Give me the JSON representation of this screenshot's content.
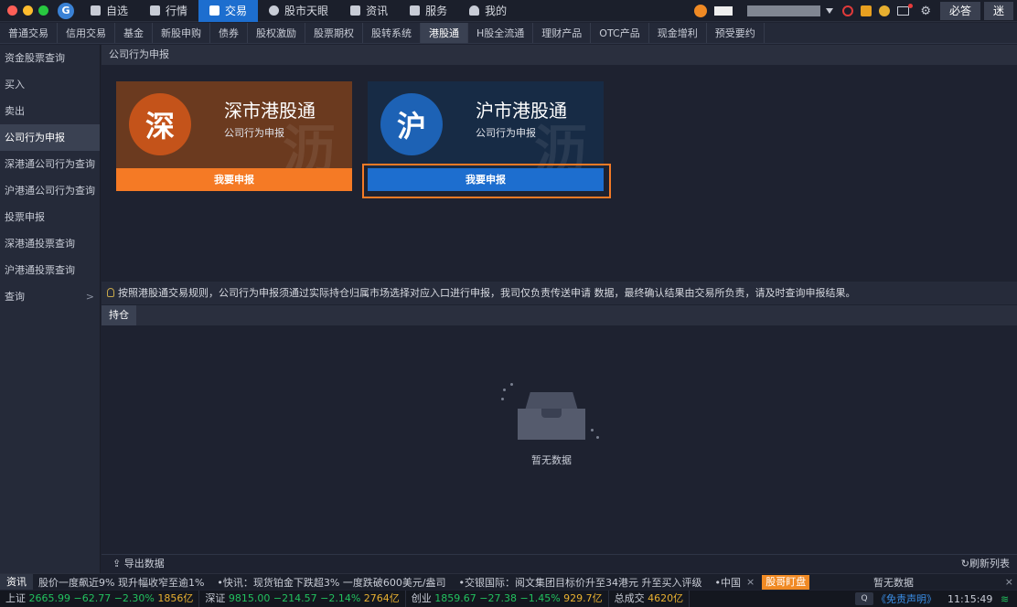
{
  "topnav": [
    {
      "label": "自选",
      "icon": "star-square-icon"
    },
    {
      "label": "行情",
      "icon": "chart-icon"
    },
    {
      "label": "交易",
      "icon": "trade-icon",
      "active": true
    },
    {
      "label": "股市天眼",
      "icon": "eye-icon"
    },
    {
      "label": "资讯",
      "icon": "news-icon"
    },
    {
      "label": "服务",
      "icon": "service-icon"
    },
    {
      "label": "我的",
      "icon": "user-icon"
    }
  ],
  "topright": {
    "bida": "必答",
    "mi": "迷"
  },
  "tabs": [
    "普通交易",
    "信用交易",
    "基金",
    "新股申购",
    "债券",
    "股权激励",
    "股票期权",
    "股转系统",
    "港股通",
    "H股全流通",
    "理财产品",
    "OTC产品",
    "现金增利",
    "预受要约"
  ],
  "active_tab": "港股通",
  "sidebar": [
    {
      "label": "资金股票查询"
    },
    {
      "label": "买入"
    },
    {
      "label": "卖出"
    },
    {
      "label": "公司行为申报",
      "active": true
    },
    {
      "label": "深港通公司行为查询"
    },
    {
      "label": "沪港通公司行为查询"
    },
    {
      "label": "投票申报"
    },
    {
      "label": "深港通投票查询"
    },
    {
      "label": "沪港通投票查询"
    },
    {
      "label": "查询",
      "chevron": ">"
    }
  ],
  "main": {
    "section_title": "公司行为申报",
    "cards": [
      {
        "char": "深",
        "title": "深市港股通",
        "subtitle": "公司行为申报",
        "button": "我要申报",
        "watermark": "沥"
      },
      {
        "char": "沪",
        "title": "沪市港股通",
        "subtitle": "公司行为申报",
        "button": "我要申报",
        "watermark": "沥"
      }
    ],
    "notice": "按照港股通交易规则，公司行为申报须通过实际持仓归属市场选择对应入口进行申报，我司仅负责传送申请 数据，最终确认结果由交易所负责，请及时查询申报结果。",
    "subtab": "持仓",
    "empty_text": "暂无数据",
    "export_label": "导出数据",
    "refresh_label": "刷新列表"
  },
  "news": {
    "label": "资讯",
    "items": [
      "股价一度飙近9% 现升幅收窄至逾1%",
      "•快讯：现货铂金下跌超3% 一度跌破600美元/盎司",
      "•交银国际：阅文集团目标价升至34港元 升至买入评级",
      "•中国"
    ],
    "badge": "股哥盯盘",
    "nodata": "暂无数据"
  },
  "status": {
    "sh": {
      "name": "上证",
      "price": "2665.99",
      "chg": "−62.77",
      "pct": "−2.30%",
      "vol": "1856亿"
    },
    "sz": {
      "name": "深证",
      "price": "9815.00",
      "chg": "−214.57",
      "pct": "−2.14%",
      "vol": "2764亿"
    },
    "cy": {
      "name": "创业",
      "price": "1859.67",
      "chg": "−27.38",
      "pct": "−1.45%",
      "vol": "929.7亿"
    },
    "total": {
      "name": "总成交",
      "vol": "4620亿"
    },
    "disclaimer": "《免责声明》",
    "time": "11:15:49"
  },
  "colors": {
    "orange": "#f57a25",
    "blue": "#1d6ecf",
    "green": "#22c15e"
  }
}
